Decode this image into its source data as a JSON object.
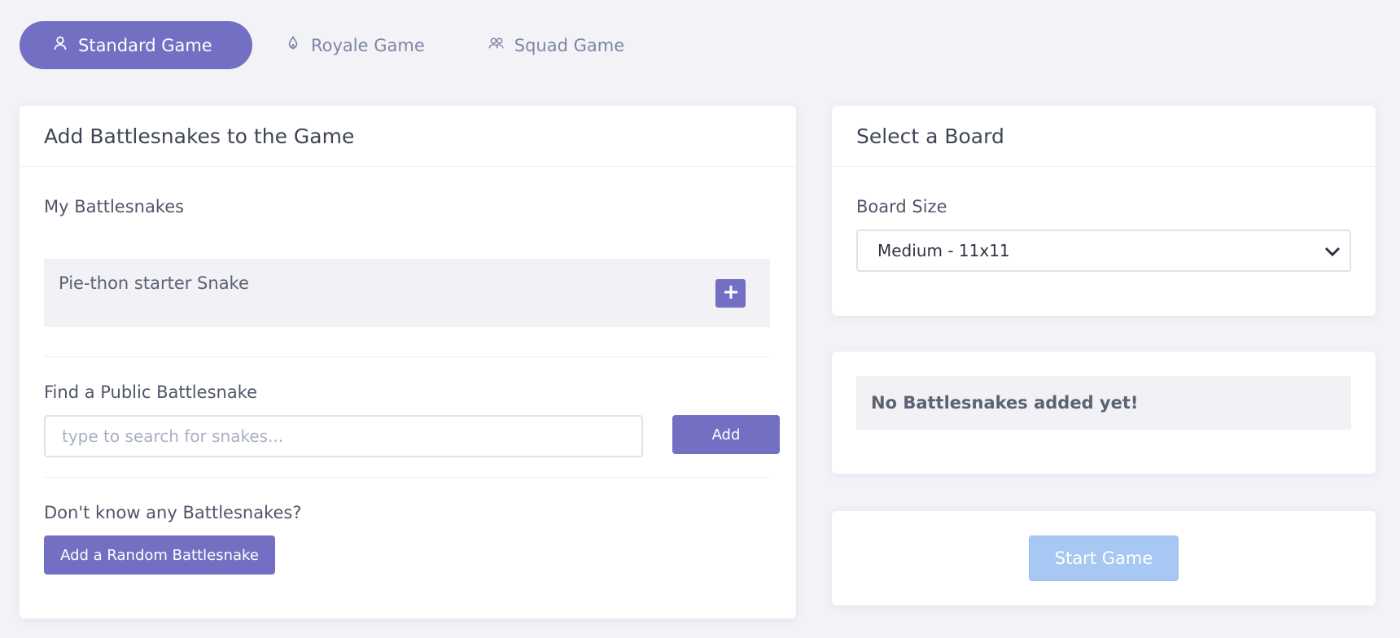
{
  "tabs": [
    {
      "label": "Standard Game",
      "icon": "person-icon",
      "active": true
    },
    {
      "label": "Royale Game",
      "icon": "flame-icon",
      "active": false
    },
    {
      "label": "Squad Game",
      "icon": "group-icon",
      "active": false
    }
  ],
  "add_card": {
    "title": "Add Battlesnakes to the Game",
    "my_label": "My Battlesnakes",
    "my_snakes": [
      {
        "name": "Pie-thon starter Snake"
      }
    ],
    "find_label": "Find a Public Battlesnake",
    "search_placeholder": "type to search for snakes...",
    "add_label": "Add",
    "random_prompt": "Don't know any Battlesnakes?",
    "random_label": "Add a Random Battlesnake"
  },
  "board_card": {
    "title": "Select a Board",
    "size_label": "Board Size",
    "size_value": "Medium - 11x11"
  },
  "status": {
    "empty_text": "No Battlesnakes added yet!"
  },
  "start": {
    "label": "Start Game"
  },
  "colors": {
    "accent": "#7370c4",
    "start_disabled": "#a7c8f2",
    "background": "#f2f2f7"
  }
}
